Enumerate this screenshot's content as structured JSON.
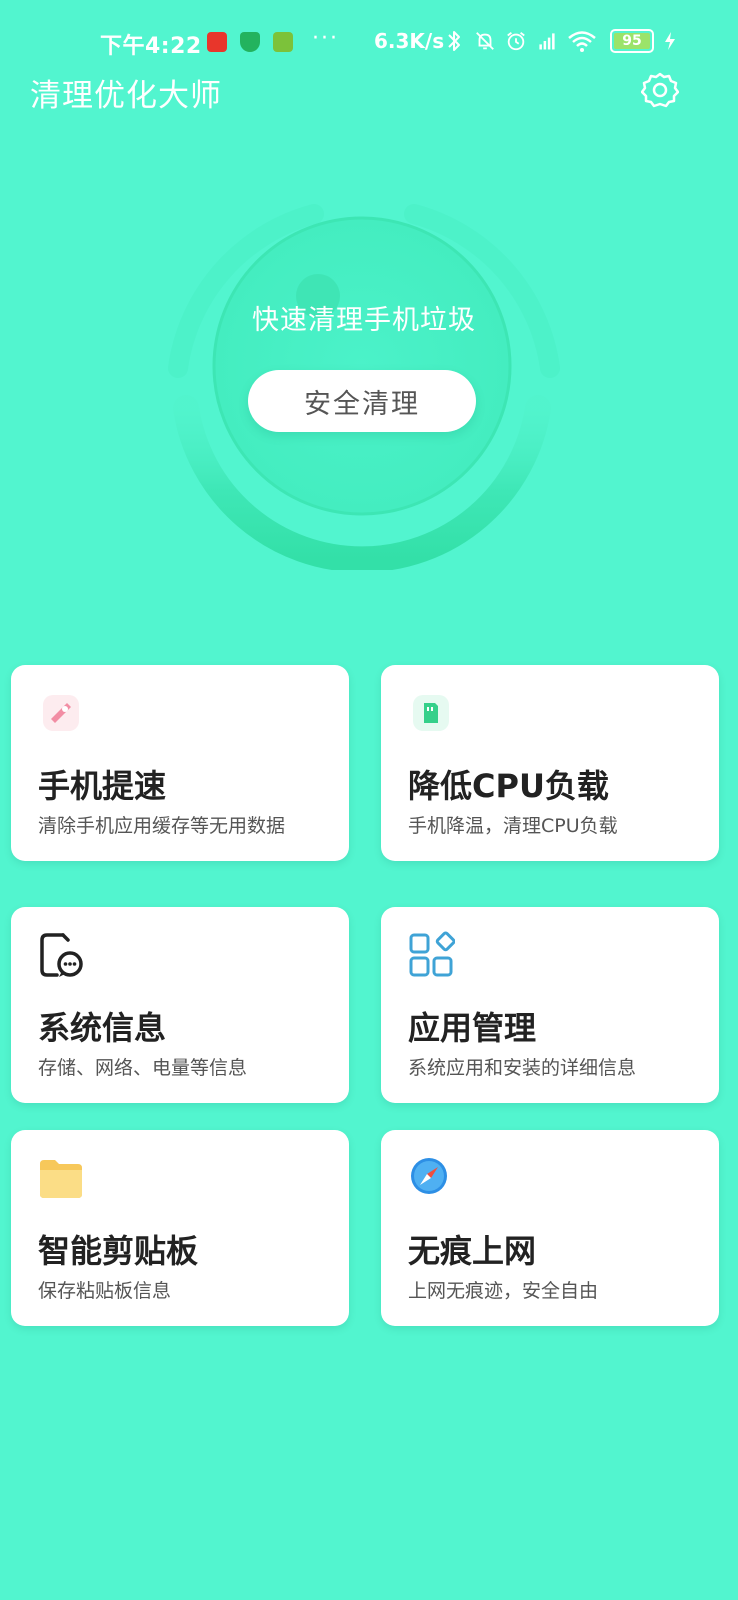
{
  "status_bar": {
    "time": "下午4:22",
    "dots": "···",
    "speed": "6.3K/s",
    "battery": "95"
  },
  "header": {
    "title": "清理优化大师"
  },
  "hero": {
    "subtitle": "快速清理手机垃圾",
    "button_label": "安全清理"
  },
  "features": [
    {
      "title": "手机提速",
      "desc": "清除手机应用缓存等无用数据",
      "icon": "rocket-icon"
    },
    {
      "title": "降低CPU负载",
      "desc": "手机降温，清理CPU负载",
      "icon": "chip-icon"
    },
    {
      "title": "系统信息",
      "desc": "存储、网络、电量等信息",
      "icon": "phone-message-icon"
    },
    {
      "title": "应用管理",
      "desc": "系统应用和安装的详细信息",
      "icon": "apps-grid-icon"
    },
    {
      "title": "智能剪贴板",
      "desc": "保存粘贴板信息",
      "icon": "folder-icon"
    },
    {
      "title": "无痕上网",
      "desc": "上网无痕迹，安全自由",
      "icon": "compass-icon"
    }
  ],
  "colors": {
    "background": "#52F5CF",
    "hero_circle": "#3FE8B4",
    "card": "#FFFFFF",
    "title_text": "#222222",
    "desc_text": "#555555"
  }
}
